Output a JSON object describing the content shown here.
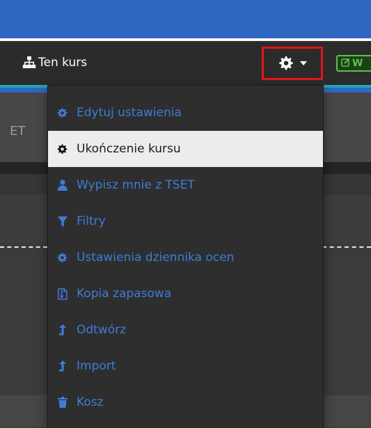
{
  "navbar": {
    "course_link_label": "Ten kurs",
    "edit_button_label": "W"
  },
  "background": {
    "left_fragment": "ET"
  },
  "menu": {
    "items": [
      {
        "label": "Edytuj ustawienia",
        "icon": "gear-icon"
      },
      {
        "label": "Ukończenie kursu",
        "icon": "gear-icon",
        "active": true
      },
      {
        "label": "Wypisz mnie z TSET",
        "icon": "user-icon"
      },
      {
        "label": "Filtry",
        "icon": "filter-icon"
      },
      {
        "label": "Ustawienia dziennika ocen",
        "icon": "gear-icon"
      },
      {
        "label": "Kopia zapasowa",
        "icon": "file-archive-icon"
      },
      {
        "label": "Odtwórz",
        "icon": "upload-icon"
      },
      {
        "label": "Import",
        "icon": "upload-icon"
      },
      {
        "label": "Kosz",
        "icon": "trash-icon"
      }
    ]
  },
  "colors": {
    "topbar": "#2f66c2",
    "navbar": "#2b2b2b",
    "menu_link": "#3f7cd8",
    "highlight_border": "#e3141a",
    "edit_accent": "#5cc24b"
  }
}
